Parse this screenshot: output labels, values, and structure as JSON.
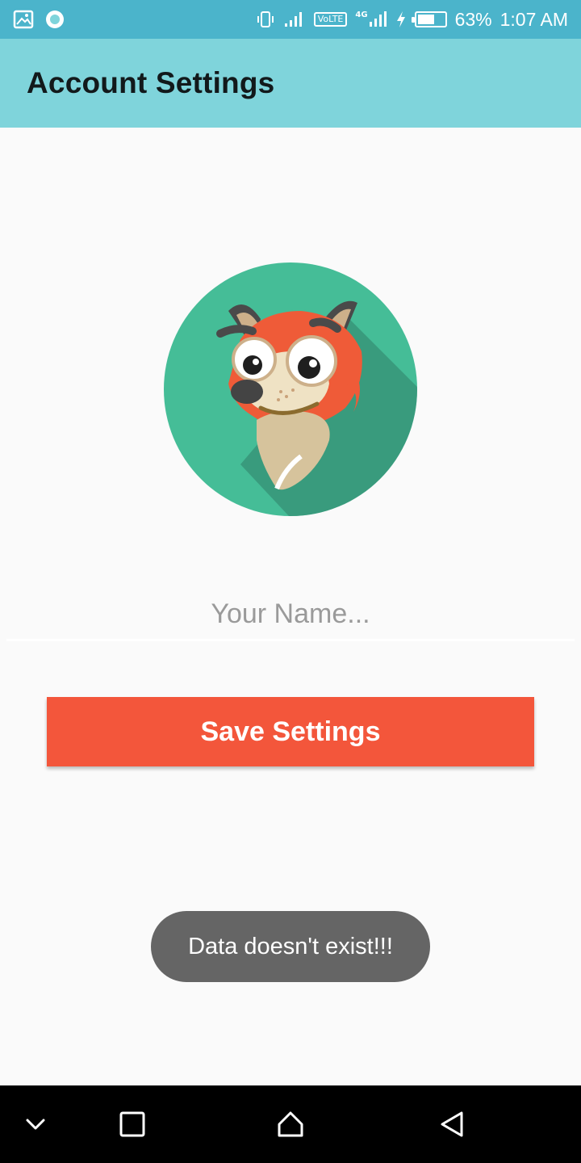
{
  "status_bar": {
    "left_icons": [
      "image-icon",
      "circle-notification-icon"
    ],
    "right_icons": [
      "vibrate-icon",
      "signal-icon",
      "volte-badge",
      "signal-4g-icon",
      "charging-icon",
      "battery-icon"
    ],
    "volte_label": "VoLTE",
    "network_label": "4G",
    "battery_percent": "63%",
    "battery_level": 0.63,
    "time": "1:07 AM"
  },
  "app_bar": {
    "title": "Account Settings"
  },
  "avatar": {
    "icon": "fox-avatar-icon",
    "background_color": "#45bd97"
  },
  "form": {
    "name_placeholder": "Your Name...",
    "name_value": "",
    "save_label": "Save Settings"
  },
  "toast": {
    "message": "Data doesn't exist!!!"
  },
  "nav_bar": {
    "items": [
      "chevron-down-icon",
      "recents-square-icon",
      "home-icon",
      "back-triangle-icon"
    ]
  },
  "colors": {
    "status_bar": "#4bb4cb",
    "app_bar": "#7fd4db",
    "accent_button": "#f3563b",
    "toast_bg": "#656565"
  }
}
